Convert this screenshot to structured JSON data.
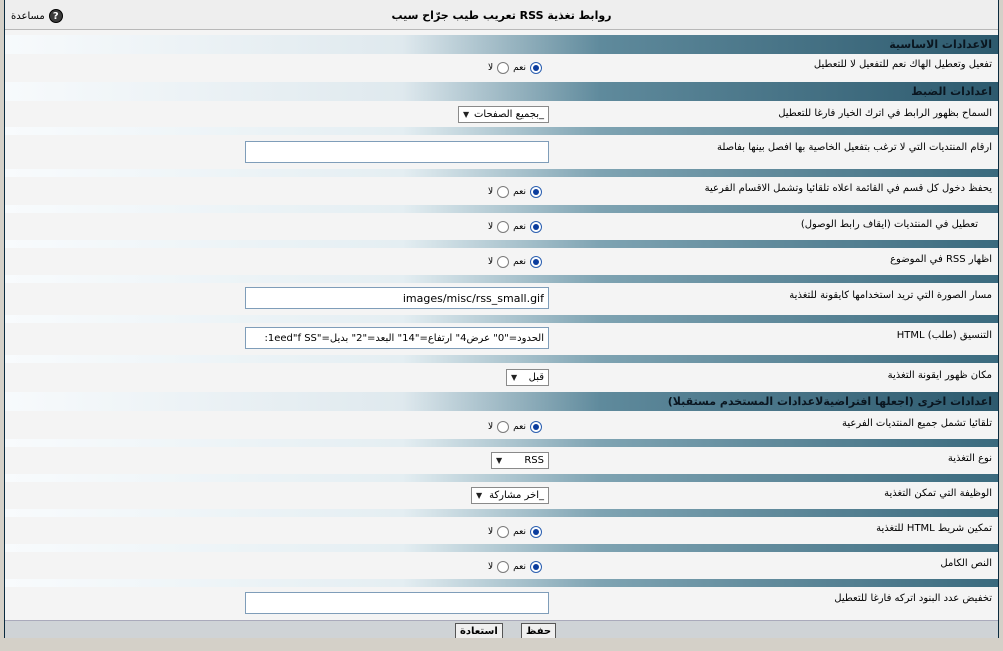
{
  "window": {
    "title": "روابط تغذية RSS تعريب طيب جرّاح سيب",
    "help_label": "مساعدة",
    "help_icon": "question-icon"
  },
  "sections": {
    "basic": "الاعدادات الاساسية",
    "control": "اعدادات الضبط",
    "other": "اعدادات اخرى (اجعلها افتراضيةلاعدادات المستخدم مستقبلا)"
  },
  "radio_labels": {
    "yes": "نعم",
    "no": "لا"
  },
  "rows": {
    "enable_hack": {
      "label": "تفعيل وتعطيل الهاك نعم للتفعيل لا للتعطيل",
      "value": "yes"
    },
    "allow_link": {
      "label": "السماح بظهور الرابط في اترك الخيار فارغا للتعطيل",
      "selected": "_بجميع الصفحات"
    },
    "forum_ids": {
      "label": "ارقام المنتديات التي لا ترغب بتفعيل الخاصية بها افصل بينها بفاصلة",
      "value": ""
    },
    "auto_include": {
      "label": "يحفظ دخول كل قسم في القائمة اعلاه تلقائيا وتشمل الاقسام الفرعية",
      "value": "yes"
    },
    "disable_forums": {
      "label": "تعطيل في المنتديات (ايقاف رابط الوصول)",
      "value": "yes"
    },
    "show_in_thread": {
      "label": "اظهار RSS في الموضوع",
      "value": "yes"
    },
    "image_path": {
      "label": "مسار الصورة التي تريد استخدامها كايقونة للتغذية",
      "value": "images/misc/rss_small.gif"
    },
    "html_format": {
      "label": "التنسيق (طلب) HTML",
      "value": "الحدود=\"0\" عرض4\" ارتفاع=\"14\" البعد=\"2\" بديل=\"1eed\"f SS:"
    },
    "icon_position": {
      "label": "مكان ظهور ايقونة التغذية",
      "selected": "قبل"
    },
    "include_sub": {
      "label": "تلقائيا تشمل جميع المنتديات الفرعية",
      "value": "yes"
    },
    "feed_type": {
      "label": "نوع التغذية",
      "selected": "RSS"
    },
    "feed_function": {
      "label": "الوظيفة التي تمكن التغذية",
      "selected": "_اخر مشاركة"
    },
    "html_bar": {
      "label": "تمكين شريط HTML للتغذية",
      "value": "yes"
    },
    "full_text": {
      "label": "النص الكامل",
      "value": "yes"
    },
    "reduce_items": {
      "label": "تخفيض عدد البنود اتركه فارغا للتعطيل",
      "value": ""
    }
  },
  "buttons": {
    "save": "حفظ",
    "reset": "استعادة"
  }
}
